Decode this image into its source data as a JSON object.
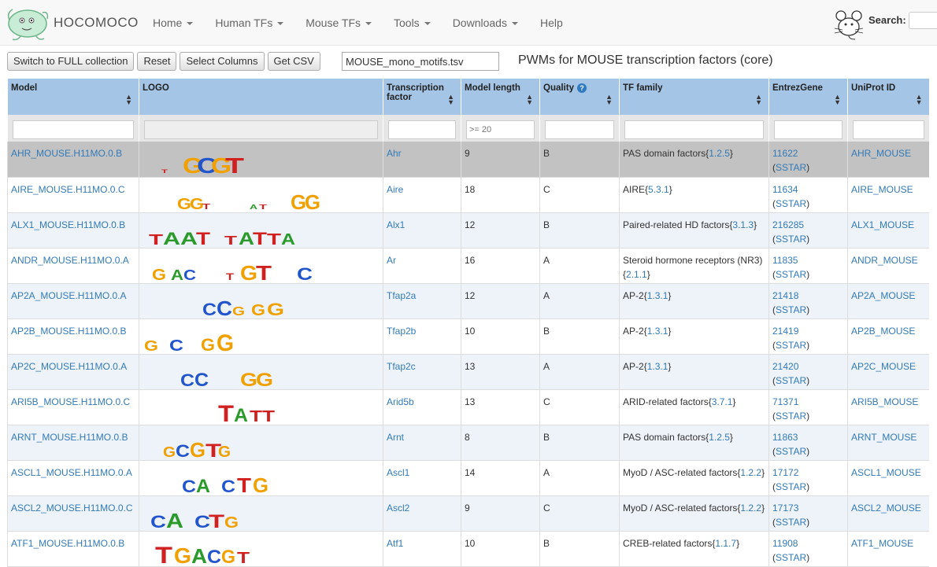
{
  "navbar": {
    "brand": "HOCOMOCO",
    "items": [
      "Home",
      "Human TFs",
      "Mouse TFs",
      "Tools",
      "Downloads",
      "Help"
    ],
    "search_label": "Search:"
  },
  "toolbar": {
    "switch_label": "Switch to FULL collection",
    "reset_label": "Reset",
    "select_columns_label": "Select Columns",
    "get_csv_label": "Get CSV",
    "filename": "MOUSE_mono_motifs.tsv",
    "title": "PWMs for MOUSE transcription factors (core)"
  },
  "table": {
    "headers": {
      "model": "Model",
      "logo": "LOGO",
      "tf": "Transcription factor",
      "length": "Model length",
      "quality": "Quality",
      "quality_icon": "?",
      "family": "TF family",
      "entrez": "EntrezGene",
      "uniprot": "UniProt ID"
    },
    "length_filter_placeholder": ">= 20",
    "sstar": "SSTAR",
    "rows": [
      {
        "model": "AHR_MOUSE.H11MO.0.B",
        "tf": "Ahr",
        "length": "9",
        "quality": "B",
        "family": "PAS domain factors",
        "family_code": "1.2.5",
        "entrez": "11622",
        "uniprot": "AHR_MOUSE"
      },
      {
        "model": "AIRE_MOUSE.H11MO.0.C",
        "tf": "Aire",
        "length": "18",
        "quality": "C",
        "family": "AIRE",
        "family_code": "5.3.1",
        "entrez": "11634",
        "uniprot": "AIRE_MOUSE"
      },
      {
        "model": "ALX1_MOUSE.H11MO.0.B",
        "tf": "Alx1",
        "length": "12",
        "quality": "B",
        "family": "Paired-related HD factors",
        "family_code": "3.1.3",
        "entrez": "216285",
        "uniprot": "ALX1_MOUSE"
      },
      {
        "model": "ANDR_MOUSE.H11MO.0.A",
        "tf": "Ar",
        "length": "16",
        "quality": "A",
        "family": "Steroid hormone receptors (NR3)",
        "family_code": "2.1.1",
        "entrez": "11835",
        "uniprot": "ANDR_MOUSE"
      },
      {
        "model": "AP2A_MOUSE.H11MO.0.A",
        "tf": "Tfap2a",
        "length": "12",
        "quality": "A",
        "family": "AP-2",
        "family_code": "1.3.1",
        "entrez": "21418",
        "uniprot": "AP2A_MOUSE"
      },
      {
        "model": "AP2B_MOUSE.H11MO.0.B",
        "tf": "Tfap2b",
        "length": "10",
        "quality": "B",
        "family": "AP-2",
        "family_code": "1.3.1",
        "entrez": "21419",
        "uniprot": "AP2B_MOUSE"
      },
      {
        "model": "AP2C_MOUSE.H11MO.0.A",
        "tf": "Tfap2c",
        "length": "13",
        "quality": "A",
        "family": "AP-2",
        "family_code": "1.3.1",
        "entrez": "21420",
        "uniprot": "AP2C_MOUSE"
      },
      {
        "model": "ARI5B_MOUSE.H11MO.0.C",
        "tf": "Arid5b",
        "length": "13",
        "quality": "C",
        "family": "ARID-related factors",
        "family_code": "3.7.1",
        "entrez": "71371",
        "uniprot": "ARI5B_MOUSE"
      },
      {
        "model": "ARNT_MOUSE.H11MO.0.B",
        "tf": "Arnt",
        "length": "8",
        "quality": "B",
        "family": "PAS domain factors",
        "family_code": "1.2.5",
        "entrez": "11863",
        "uniprot": "ARNT_MOUSE"
      },
      {
        "model": "ASCL1_MOUSE.H11MO.0.A",
        "tf": "Ascl1",
        "length": "14",
        "quality": "A",
        "family": "MyoD / ASC-related factors",
        "family_code": "1.2.2",
        "entrez": "17172",
        "uniprot": "ASCL1_MOUSE"
      },
      {
        "model": "ASCL2_MOUSE.H11MO.0.C",
        "tf": "Ascl2",
        "length": "9",
        "quality": "C",
        "family": "MyoD / ASC-related factors",
        "family_code": "1.2.2",
        "entrez": "17173",
        "uniprot": "ASCL2_MOUSE"
      },
      {
        "model": "ATF1_MOUSE.H11MO.0.B",
        "tf": "Atf1",
        "length": "10",
        "quality": "B",
        "family": "CREB-related factors",
        "family_code": "1.1.7",
        "entrez": "11908",
        "uniprot": "ATF1_MOUSE"
      }
    ]
  },
  "logo_colors": {
    "A": "#2a9a2a",
    "C": "#2255cc",
    "G": "#f0a000",
    "T": "#d02020"
  }
}
